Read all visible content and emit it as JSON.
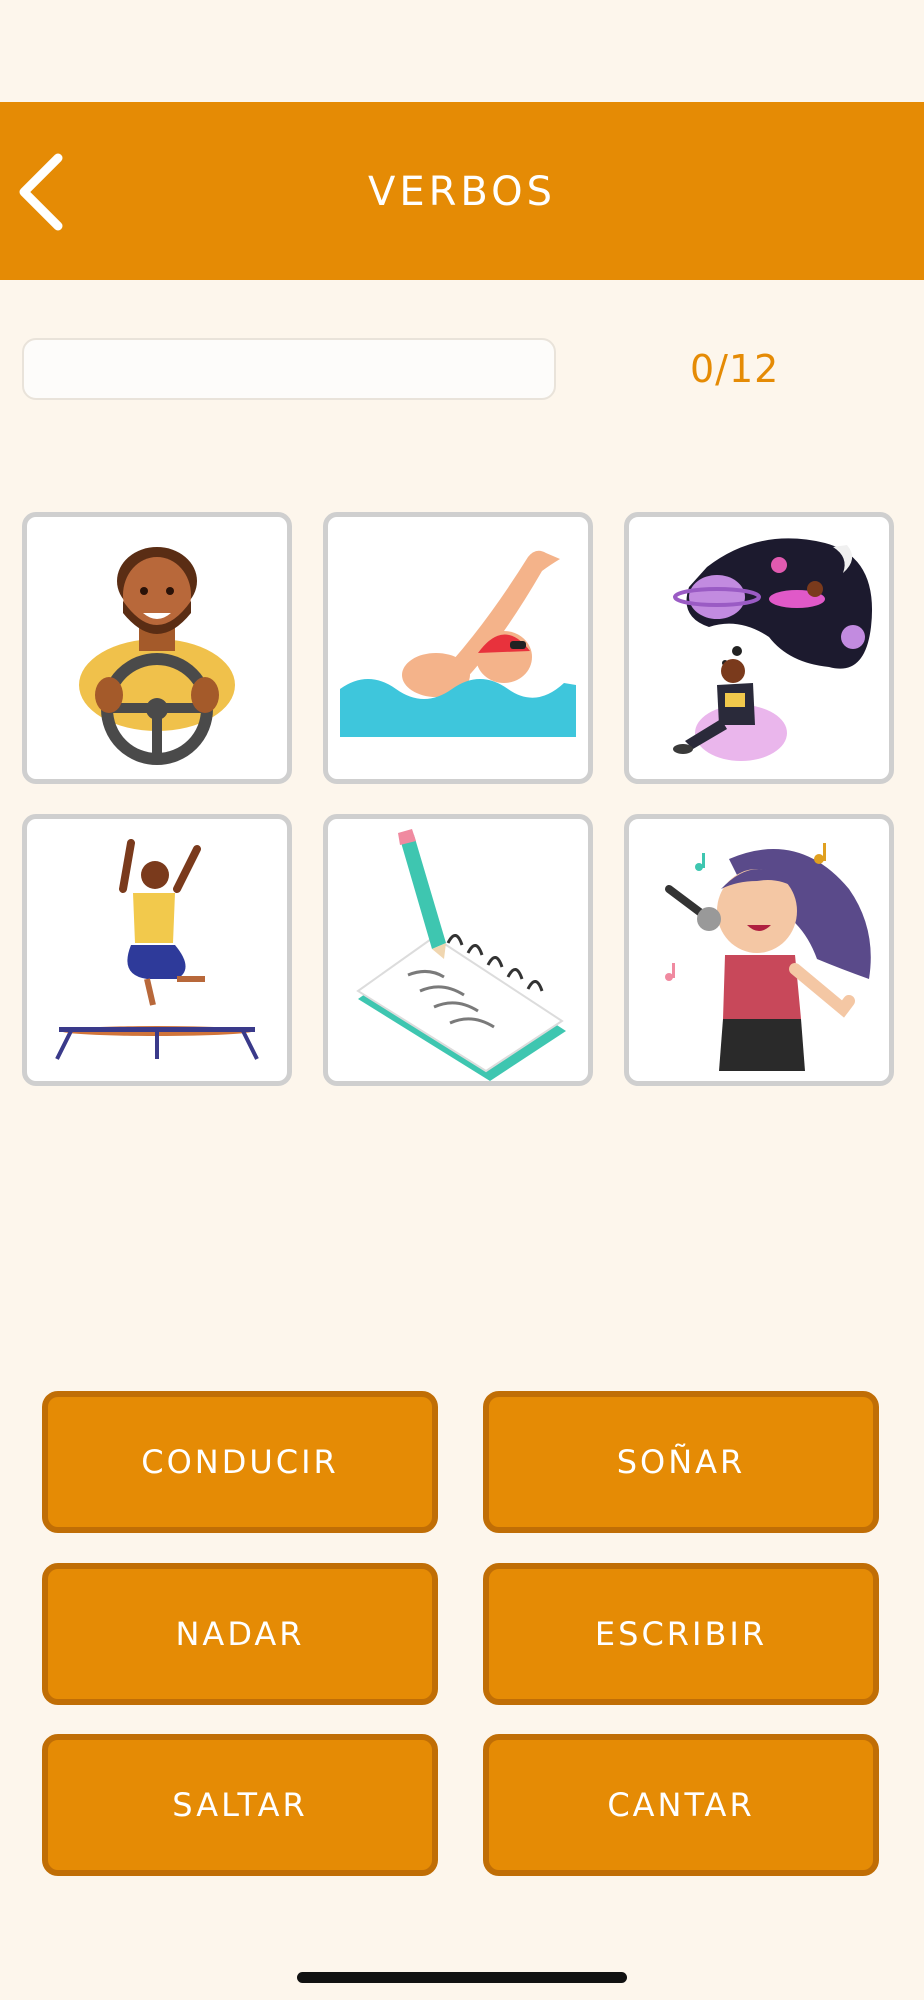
{
  "header": {
    "title": "VERBOS"
  },
  "progress": {
    "count_text": "0/12",
    "fraction": 0
  },
  "cards": [
    {
      "icon": "driver-icon"
    },
    {
      "icon": "swimmer-icon"
    },
    {
      "icon": "dreamer-icon"
    },
    {
      "icon": "trampoline-jumper-icon"
    },
    {
      "icon": "notebook-writing-icon"
    },
    {
      "icon": "singer-icon"
    }
  ],
  "answers": [
    {
      "label": "CONDUCIR"
    },
    {
      "label": "SOÑAR"
    },
    {
      "label": "NADAR"
    },
    {
      "label": "ESCRIBIR"
    },
    {
      "label": "SALTAR"
    },
    {
      "label": "CANTAR"
    }
  ],
  "colors": {
    "accent": "#e58b05",
    "accent_dark": "#c06e06",
    "background": "#fdf6ec"
  }
}
